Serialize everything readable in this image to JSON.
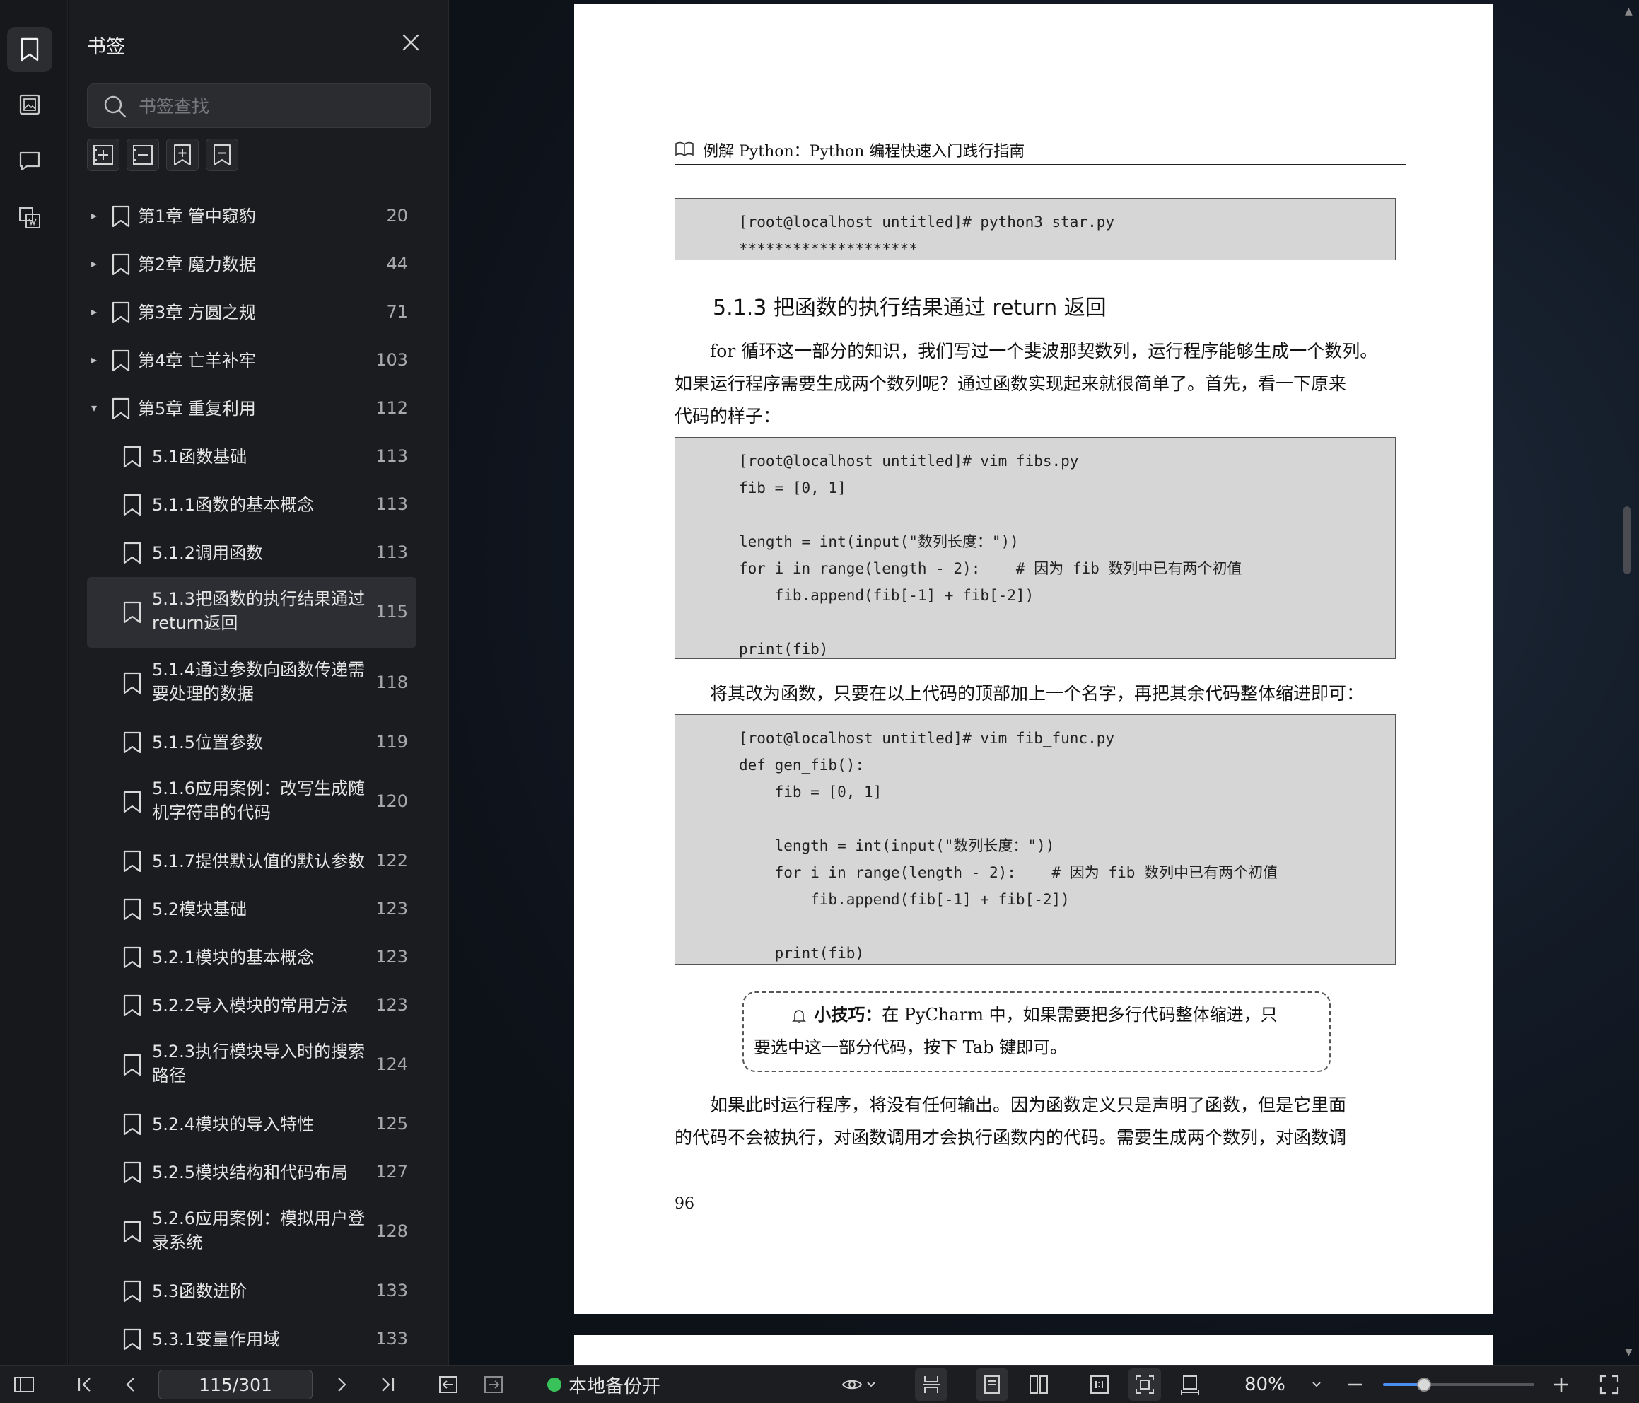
{
  "panel": {
    "title": "书签",
    "search_placeholder": "书签查找"
  },
  "bookmarks": [
    {
      "label": "第1章  管中窥豹",
      "page": "20",
      "level": 1,
      "caret": "▸"
    },
    {
      "label": "第2章  魔力数据",
      "page": "44",
      "level": 1,
      "caret": "▸"
    },
    {
      "label": "第3章  方圆之规",
      "page": "71",
      "level": 1,
      "caret": "▸"
    },
    {
      "label": "第4章  亡羊补牢",
      "page": "103",
      "level": 1,
      "caret": "▸"
    },
    {
      "label": "第5章  重复利用",
      "page": "112",
      "level": 1,
      "caret": "▾"
    },
    {
      "label": "5.1函数基础",
      "page": "113",
      "level": 2
    },
    {
      "label": "5.1.1函数的基本概念",
      "page": "113",
      "level": 2
    },
    {
      "label": "5.1.2调用函数",
      "page": "113",
      "level": 2
    },
    {
      "label": "5.1.3把函数的执行结果通过return返回",
      "page": "115",
      "level": 2,
      "selected": true
    },
    {
      "label": "5.1.4通过参数向函数传递需要处理的数据",
      "page": "118",
      "level": 2
    },
    {
      "label": "5.1.5位置参数",
      "page": "119",
      "level": 2
    },
    {
      "label": "5.1.6应用案例：改写生成随机字符串的代码",
      "page": "120",
      "level": 2
    },
    {
      "label": "5.1.7提供默认值的默认参数",
      "page": "122",
      "level": 2
    },
    {
      "label": "5.2模块基础",
      "page": "123",
      "level": 2
    },
    {
      "label": "5.2.1模块的基本概念",
      "page": "123",
      "level": 2
    },
    {
      "label": "5.2.2导入模块的常用方法",
      "page": "123",
      "level": 2
    },
    {
      "label": "5.2.3执行模块导入时的搜索路径",
      "page": "124",
      "level": 2
    },
    {
      "label": "5.2.4模块的导入特性",
      "page": "125",
      "level": 2
    },
    {
      "label": "5.2.5模块结构和代码布局",
      "page": "127",
      "level": 2
    },
    {
      "label": "5.2.6应用案例：模拟用户登录系统",
      "page": "128",
      "level": 2
    },
    {
      "label": "5.3函数进阶",
      "page": "133",
      "level": 2
    },
    {
      "label": "5.3.1变量作用域",
      "page": "133",
      "level": 2
    }
  ],
  "document": {
    "running_head": "例解 Python：Python 编程快速入门践行指南",
    "code1": [
      "[root@localhost untitled]# python3 star.py",
      "********************"
    ],
    "section_heading": "5.1.3   把函数的执行结果通过 return 返回",
    "para1": [
      "　　for 循环这一部分的知识，我们写过一个斐波那契数列，运行程序能够生成一个数列。",
      "如果运行程序需要生成两个数列呢？通过函数实现起来就很简单了。首先，看一下原来",
      "代码的样子："
    ],
    "code2": [
      "[root@localhost untitled]# vim fibs.py",
      "fib = [0, 1]",
      "",
      "length = int(input(\"数列长度：\"))",
      "for i in range(length - 2):    # 因为 fib 数列中已有两个初值",
      "    fib.append(fib[-1] + fib[-2])",
      "",
      "print(fib)"
    ],
    "para2": "　　将其改为函数，只要在以上代码的顶部加上一个名字，再把其余代码整体缩进即可：",
    "code3": [
      "[root@localhost untitled]# vim fib_func.py",
      "def gen_fib():",
      "    fib = [0, 1]",
      "",
      "    length = int(input(\"数列长度：\"))",
      "    for i in range(length - 2):    # 因为 fib 数列中已有两个初值",
      "        fib.append(fib[-1] + fib[-2])",
      "",
      "    print(fib)"
    ],
    "tip_label": "小技巧：",
    "tip_text_1": "在 PyCharm 中，如果需要把多行代码整体缩进，只",
    "tip_text_2": "要选中这一部分代码，按下 Tab 键即可。",
    "para3": [
      "　　如果此时运行程序，将没有任何输出。因为函数定义只是声明了函数，但是它里面",
      "的代码不会被执行，对函数调用才会执行函数内的代码。需要生成两个数列，对函数调"
    ],
    "page_number": "96"
  },
  "toolbar": {
    "page_indicator": "115/301",
    "backup_status": "本地备份开",
    "zoom": "80%",
    "zoom_level": 0.27
  },
  "colors": {
    "accent": "#4a8ef0",
    "backup_on": "#3ac25a"
  }
}
